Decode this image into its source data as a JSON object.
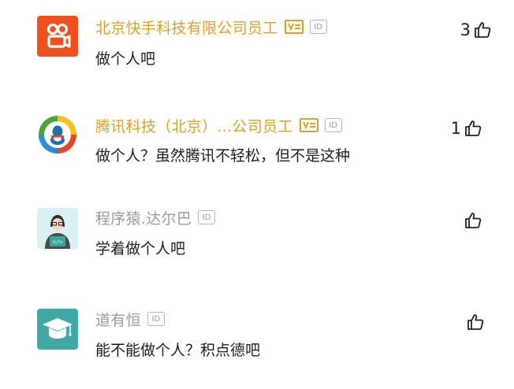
{
  "comments": [
    {
      "author": "北京快手科技有限公司员工",
      "author_style": "verified",
      "avatar": "kuaishou-logo-icon",
      "verified_badge": "verified-v-badge-icon",
      "id_badge": "ID",
      "text": "做个人吧",
      "likes": "3"
    },
    {
      "author": "腾讯科技（北京）...公司员工",
      "author_style": "verified",
      "avatar": "tencent-logo-icon",
      "verified_badge": "verified-v-badge-icon",
      "id_badge": "ID",
      "text": "做个人？虽然腾讯不轻松，但不是这种",
      "likes": "1"
    },
    {
      "author": "程序猿.达尔巴",
      "author_style": "plain",
      "avatar": "programmer-avatar-icon",
      "id_badge": "ID",
      "text": "学着做个人吧",
      "likes": ""
    },
    {
      "author": "道有恒",
      "author_style": "plain",
      "avatar": "graduation-cap-avatar-icon",
      "id_badge": "ID",
      "text": "能不能做个人？积点德吧",
      "likes": ""
    }
  ],
  "colors": {
    "verified_name": "#d9a12b",
    "plain_name": "#9a9a9a",
    "text": "#1e1e1e",
    "kuaishou_orange": "#f0501d",
    "teal_avatar": "#3fa9a4"
  }
}
